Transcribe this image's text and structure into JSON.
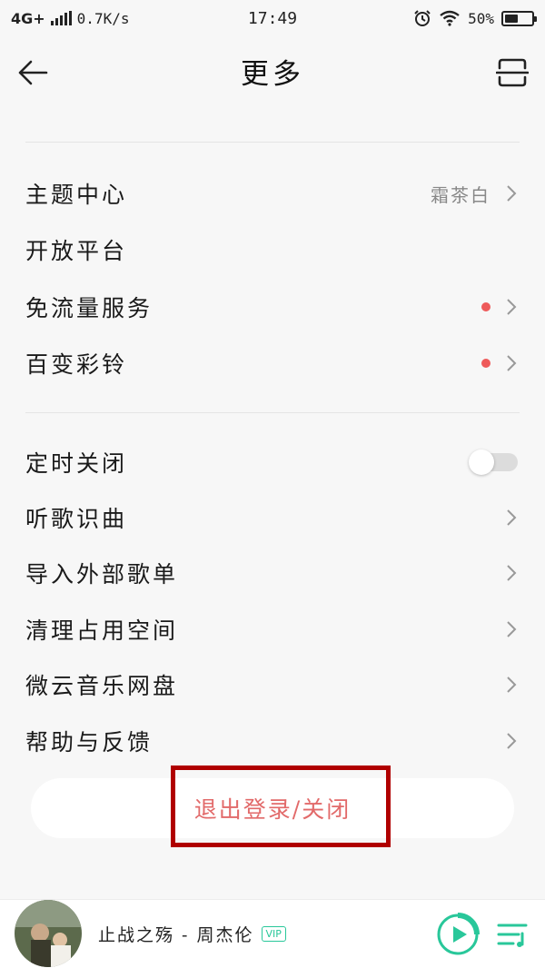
{
  "status_bar": {
    "network": "4G+",
    "speed": "0.7K/s",
    "time": "17:49",
    "battery": "50%",
    "battery_level": 0.5
  },
  "header": {
    "title": "更多",
    "back_icon": "arrow-left-icon",
    "scan_icon": "scan-icon"
  },
  "groups": [
    {
      "items": [
        {
          "label": "主题中心",
          "value": "霜茶白",
          "dot": false,
          "chevron": true
        },
        {
          "label": "开放平台",
          "value": "",
          "dot": false,
          "chevron": false
        },
        {
          "label": "免流量服务",
          "value": "",
          "dot": true,
          "chevron": true
        },
        {
          "label": "百变彩铃",
          "value": "",
          "dot": true,
          "chevron": true
        }
      ]
    },
    {
      "items": [
        {
          "label": "定时关闭",
          "toggle": true,
          "toggle_on": false
        },
        {
          "label": "听歌识曲",
          "chevron": true
        },
        {
          "label": "导入外部歌单",
          "chevron": true
        },
        {
          "label": "清理占用空间",
          "chevron": true
        },
        {
          "label": "微云音乐网盘",
          "chevron": true
        },
        {
          "label": "帮助与反馈",
          "chevron": true
        }
      ]
    }
  ],
  "logout": {
    "label": "退出登录/关闭"
  },
  "player": {
    "song": "止战之殇 - 周杰伦",
    "vip": "VIP"
  },
  "colors": {
    "accent_red": "#ee5a5a",
    "logout_text": "#e26a6a",
    "highlight_box": "#b00000",
    "player_green": "#29c79a",
    "background": "#f7f7f7"
  }
}
